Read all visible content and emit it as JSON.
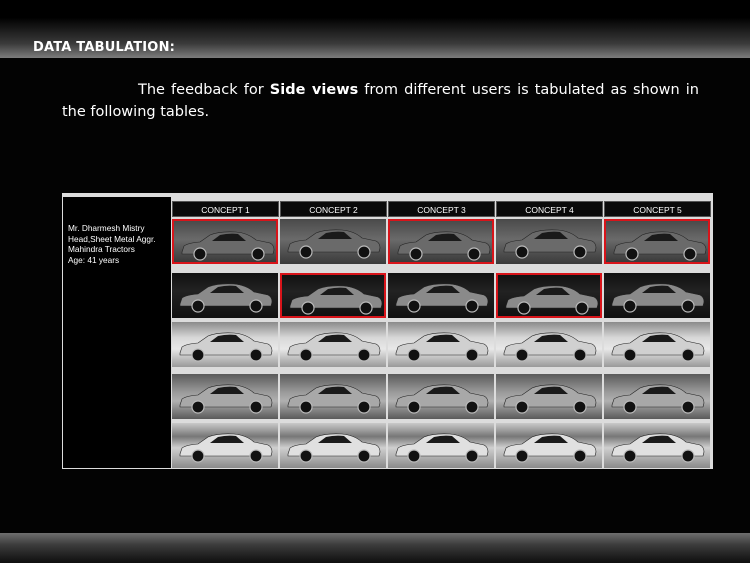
{
  "heading": "DATA TABULATION:",
  "intro": {
    "before": "The feedback for ",
    "bold": "Side views",
    "after": " from different users is tabulated as shown in the following tables."
  },
  "table": {
    "profile": [
      "Mr. Dharmesh Mistry",
      "Head,Sheet Metal Aggr.",
      "Mahindra Tractors",
      "Age: 41 years"
    ],
    "columns": [
      "CONCEPT 1",
      "CONCEPT 2",
      "CONCEPT 3",
      "CONCEPT 4",
      "CONCEPT 5"
    ],
    "rows": [
      {
        "tone": "grey",
        "car_color": "#6a6a6a",
        "selected": [
          true,
          false,
          true,
          false,
          true
        ]
      },
      {
        "tone": "dark",
        "car_color": "#8a8a8a",
        "selected": [
          false,
          true,
          false,
          true,
          false
        ]
      },
      {
        "tone": "light",
        "car_color": "#d0d0d0",
        "selected": [
          false,
          false,
          false,
          false,
          false
        ]
      },
      {
        "tone": "mid",
        "car_color": "#a8a8a8",
        "selected": [
          false,
          false,
          false,
          false,
          false
        ]
      },
      {
        "tone": "street",
        "car_color": "#e0e0e0",
        "selected": [
          false,
          false,
          false,
          false,
          false
        ]
      }
    ],
    "selection_color": "#d8141a"
  }
}
